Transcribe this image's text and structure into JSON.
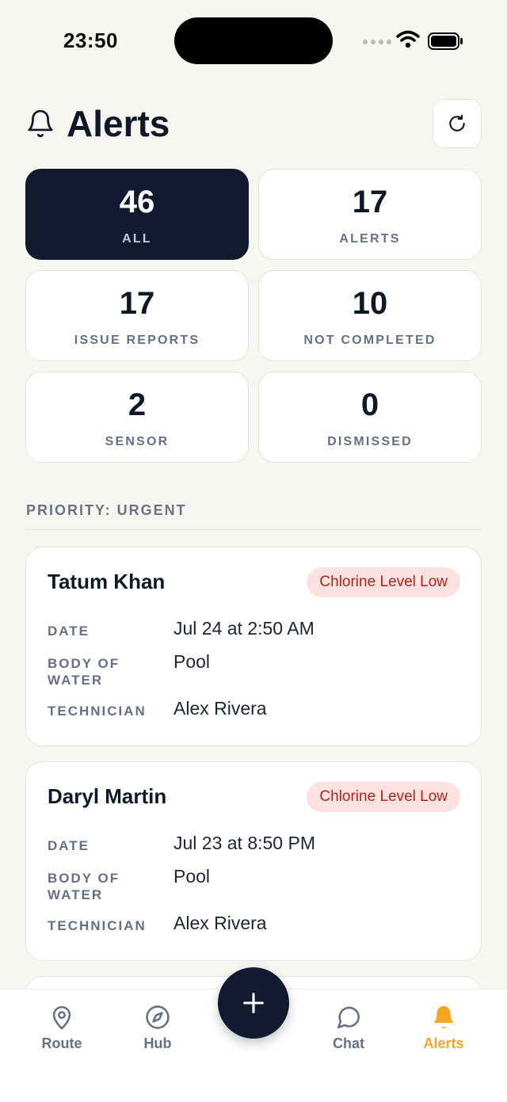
{
  "status_bar": {
    "time": "23:50"
  },
  "header": {
    "title": "Alerts",
    "icon": "bell-icon",
    "refresh_icon": "refresh-icon"
  },
  "stats": [
    {
      "value": "46",
      "label": "ALL",
      "active": true
    },
    {
      "value": "17",
      "label": "ALERTS",
      "active": false
    },
    {
      "value": "17",
      "label": "ISSUE REPORTS",
      "active": false
    },
    {
      "value": "10",
      "label": "NOT COMPLETED",
      "active": false
    },
    {
      "value": "2",
      "label": "SENSOR",
      "active": false
    },
    {
      "value": "0",
      "label": "DISMISSED",
      "active": false
    }
  ],
  "section": {
    "title": "PRIORITY: URGENT"
  },
  "detail_labels": {
    "date": "DATE",
    "body_of_water": "BODY OF WATER",
    "technician": "TECHNICIAN"
  },
  "alerts": [
    {
      "name": "Tatum Khan",
      "badge": "Chlorine Level Low",
      "date": "Jul 24 at 2:50 AM",
      "body_of_water": "Pool",
      "technician": "Alex Rivera"
    },
    {
      "name": "Daryl Martin",
      "badge": "Chlorine Level Low",
      "date": "Jul 23 at 8:50 PM",
      "body_of_water": "Pool",
      "technician": "Alex Rivera"
    }
  ],
  "tab_bar": {
    "items": [
      {
        "label": "Route",
        "icon": "map-pin-icon"
      },
      {
        "label": "Hub",
        "icon": "compass-icon"
      },
      {
        "label": "Chat",
        "icon": "chat-bubble-icon"
      },
      {
        "label": "Alerts",
        "icon": "bell-icon",
        "active": true
      }
    ],
    "fab_icon": "plus-icon"
  },
  "colors": {
    "navy": "#111a2e",
    "accent": "#f5a623",
    "badge_bg": "#fde2e2",
    "badge_text": "#b42318"
  }
}
